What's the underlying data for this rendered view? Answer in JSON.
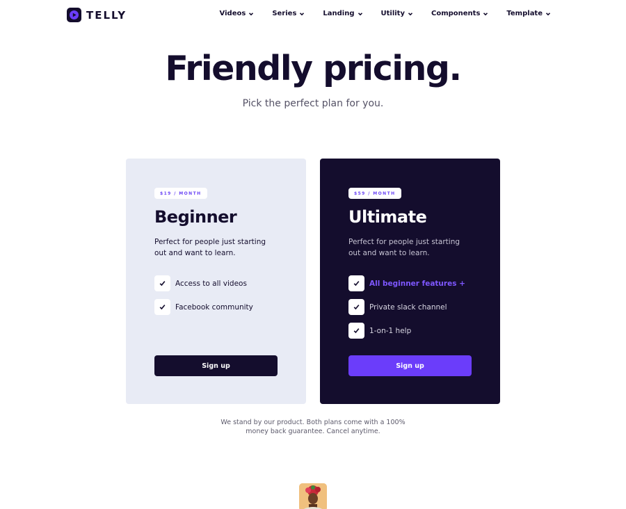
{
  "brand": {
    "name": "TELLY",
    "accent": "#6b3dfa",
    "dark": "#140d2d"
  },
  "nav": {
    "items": [
      {
        "label": "Videos",
        "icon": "chevron-down-icon"
      },
      {
        "label": "Series",
        "icon": "chevron-down-icon"
      },
      {
        "label": "Landing",
        "icon": "chevron-down-icon"
      },
      {
        "label": "Utility",
        "icon": "chevron-down-icon"
      },
      {
        "label": "Components",
        "icon": "chevron-down-icon"
      },
      {
        "label": "Template",
        "icon": "chevron-down-icon"
      }
    ]
  },
  "hero": {
    "title": "Friendly pricing.",
    "subtitle": "Pick the perfect plan for you."
  },
  "plans": [
    {
      "price": "$19 / MONTH",
      "name": "Beginner",
      "description": "Perfect for people just starting out and want to learn.",
      "features": [
        "Access to all videos",
        "Facebook community"
      ],
      "cta": "Sign up"
    },
    {
      "price": "$59 / MONTH",
      "name": "Ultimate",
      "description": "Perfect for people just starting out and want to learn.",
      "features": [
        "All beginner features +",
        "Private slack channel",
        "1-on-1 help"
      ],
      "cta": "Sign up"
    }
  ],
  "guarantee": {
    "line1": "We stand by our product. Both plans come with a 100%",
    "line2": "money back guarantee. Cancel anytime."
  }
}
